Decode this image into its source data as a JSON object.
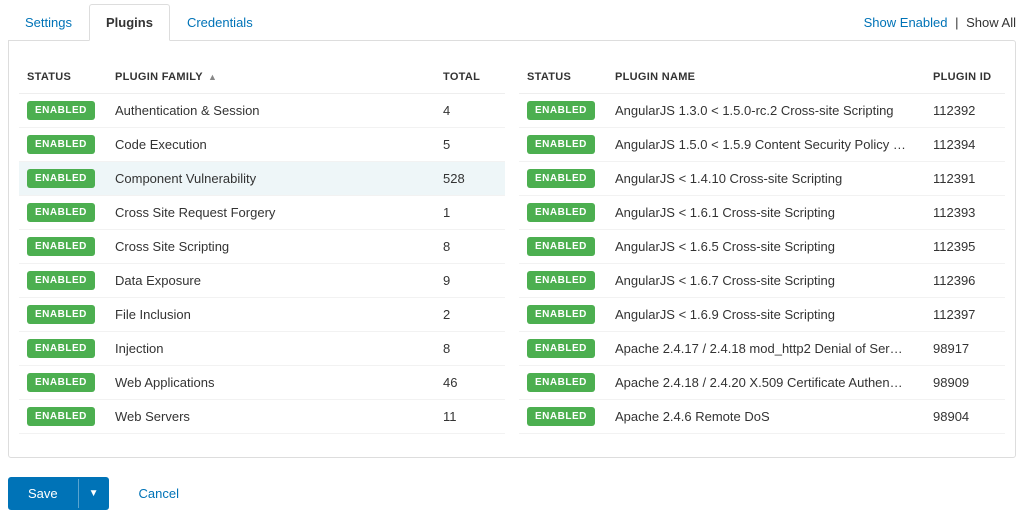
{
  "tabs": {
    "settings": "Settings",
    "plugins": "Plugins",
    "credentials": "Credentials",
    "active": "plugins"
  },
  "filter": {
    "show_enabled": "Show Enabled",
    "sep": "|",
    "show_all": "Show All"
  },
  "left": {
    "headers": {
      "status": "STATUS",
      "family": "PLUGIN FAMILY",
      "total": "TOTAL"
    },
    "sort_indicator": "▲",
    "badge_label": "ENABLED",
    "selected_index": 2,
    "rows": [
      {
        "family": "Authentication & Session",
        "total": "4"
      },
      {
        "family": "Code Execution",
        "total": "5"
      },
      {
        "family": "Component Vulnerability",
        "total": "528"
      },
      {
        "family": "Cross Site Request Forgery",
        "total": "1"
      },
      {
        "family": "Cross Site Scripting",
        "total": "8"
      },
      {
        "family": "Data Exposure",
        "total": "9"
      },
      {
        "family": "File Inclusion",
        "total": "2"
      },
      {
        "family": "Injection",
        "total": "8"
      },
      {
        "family": "Web Applications",
        "total": "46"
      },
      {
        "family": "Web Servers",
        "total": "11"
      }
    ]
  },
  "right": {
    "headers": {
      "status": "STATUS",
      "name": "PLUGIN NAME",
      "id": "PLUGIN ID"
    },
    "badge_label": "ENABLED",
    "rows": [
      {
        "name": "AngularJS 1.3.0 < 1.5.0-rc.2 Cross-site Scripting",
        "id": "112392"
      },
      {
        "name": "AngularJS 1.5.0 < 1.5.9 Content Security Policy …",
        "id": "112394"
      },
      {
        "name": "AngularJS < 1.4.10 Cross-site Scripting",
        "id": "112391"
      },
      {
        "name": "AngularJS < 1.6.1 Cross-site Scripting",
        "id": "112393"
      },
      {
        "name": "AngularJS < 1.6.5 Cross-site Scripting",
        "id": "112395"
      },
      {
        "name": "AngularJS < 1.6.7 Cross-site Scripting",
        "id": "112396"
      },
      {
        "name": "AngularJS < 1.6.9 Cross-site Scripting",
        "id": "112397"
      },
      {
        "name": "Apache 2.4.17 / 2.4.18 mod_http2 Denial of Ser…",
        "id": "98917"
      },
      {
        "name": "Apache 2.4.18 / 2.4.20 X.509 Certificate Authen…",
        "id": "98909"
      },
      {
        "name": "Apache 2.4.6 Remote DoS",
        "id": "98904"
      }
    ]
  },
  "footer": {
    "save": "Save",
    "caret": "▼",
    "cancel": "Cancel"
  }
}
